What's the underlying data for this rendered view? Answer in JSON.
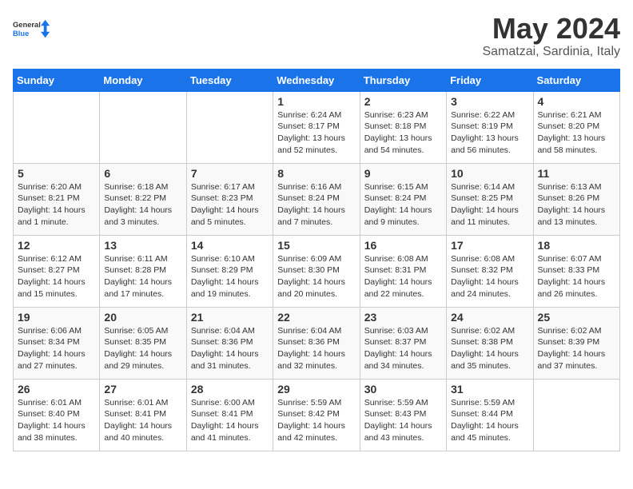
{
  "header": {
    "logo_general": "General",
    "logo_blue": "Blue",
    "title": "May 2024",
    "subtitle": "Samatzai, Sardinia, Italy"
  },
  "days_of_week": [
    "Sunday",
    "Monday",
    "Tuesday",
    "Wednesday",
    "Thursday",
    "Friday",
    "Saturday"
  ],
  "weeks": [
    [
      {
        "day": "",
        "info": ""
      },
      {
        "day": "",
        "info": ""
      },
      {
        "day": "",
        "info": ""
      },
      {
        "day": "1",
        "info": "Sunrise: 6:24 AM\nSunset: 8:17 PM\nDaylight: 13 hours\nand 52 minutes."
      },
      {
        "day": "2",
        "info": "Sunrise: 6:23 AM\nSunset: 8:18 PM\nDaylight: 13 hours\nand 54 minutes."
      },
      {
        "day": "3",
        "info": "Sunrise: 6:22 AM\nSunset: 8:19 PM\nDaylight: 13 hours\nand 56 minutes."
      },
      {
        "day": "4",
        "info": "Sunrise: 6:21 AM\nSunset: 8:20 PM\nDaylight: 13 hours\nand 58 minutes."
      }
    ],
    [
      {
        "day": "5",
        "info": "Sunrise: 6:20 AM\nSunset: 8:21 PM\nDaylight: 14 hours\nand 1 minute."
      },
      {
        "day": "6",
        "info": "Sunrise: 6:18 AM\nSunset: 8:22 PM\nDaylight: 14 hours\nand 3 minutes."
      },
      {
        "day": "7",
        "info": "Sunrise: 6:17 AM\nSunset: 8:23 PM\nDaylight: 14 hours\nand 5 minutes."
      },
      {
        "day": "8",
        "info": "Sunrise: 6:16 AM\nSunset: 8:24 PM\nDaylight: 14 hours\nand 7 minutes."
      },
      {
        "day": "9",
        "info": "Sunrise: 6:15 AM\nSunset: 8:24 PM\nDaylight: 14 hours\nand 9 minutes."
      },
      {
        "day": "10",
        "info": "Sunrise: 6:14 AM\nSunset: 8:25 PM\nDaylight: 14 hours\nand 11 minutes."
      },
      {
        "day": "11",
        "info": "Sunrise: 6:13 AM\nSunset: 8:26 PM\nDaylight: 14 hours\nand 13 minutes."
      }
    ],
    [
      {
        "day": "12",
        "info": "Sunrise: 6:12 AM\nSunset: 8:27 PM\nDaylight: 14 hours\nand 15 minutes."
      },
      {
        "day": "13",
        "info": "Sunrise: 6:11 AM\nSunset: 8:28 PM\nDaylight: 14 hours\nand 17 minutes."
      },
      {
        "day": "14",
        "info": "Sunrise: 6:10 AM\nSunset: 8:29 PM\nDaylight: 14 hours\nand 19 minutes."
      },
      {
        "day": "15",
        "info": "Sunrise: 6:09 AM\nSunset: 8:30 PM\nDaylight: 14 hours\nand 20 minutes."
      },
      {
        "day": "16",
        "info": "Sunrise: 6:08 AM\nSunset: 8:31 PM\nDaylight: 14 hours\nand 22 minutes."
      },
      {
        "day": "17",
        "info": "Sunrise: 6:08 AM\nSunset: 8:32 PM\nDaylight: 14 hours\nand 24 minutes."
      },
      {
        "day": "18",
        "info": "Sunrise: 6:07 AM\nSunset: 8:33 PM\nDaylight: 14 hours\nand 26 minutes."
      }
    ],
    [
      {
        "day": "19",
        "info": "Sunrise: 6:06 AM\nSunset: 8:34 PM\nDaylight: 14 hours\nand 27 minutes."
      },
      {
        "day": "20",
        "info": "Sunrise: 6:05 AM\nSunset: 8:35 PM\nDaylight: 14 hours\nand 29 minutes."
      },
      {
        "day": "21",
        "info": "Sunrise: 6:04 AM\nSunset: 8:36 PM\nDaylight: 14 hours\nand 31 minutes."
      },
      {
        "day": "22",
        "info": "Sunrise: 6:04 AM\nSunset: 8:36 PM\nDaylight: 14 hours\nand 32 minutes."
      },
      {
        "day": "23",
        "info": "Sunrise: 6:03 AM\nSunset: 8:37 PM\nDaylight: 14 hours\nand 34 minutes."
      },
      {
        "day": "24",
        "info": "Sunrise: 6:02 AM\nSunset: 8:38 PM\nDaylight: 14 hours\nand 35 minutes."
      },
      {
        "day": "25",
        "info": "Sunrise: 6:02 AM\nSunset: 8:39 PM\nDaylight: 14 hours\nand 37 minutes."
      }
    ],
    [
      {
        "day": "26",
        "info": "Sunrise: 6:01 AM\nSunset: 8:40 PM\nDaylight: 14 hours\nand 38 minutes."
      },
      {
        "day": "27",
        "info": "Sunrise: 6:01 AM\nSunset: 8:41 PM\nDaylight: 14 hours\nand 40 minutes."
      },
      {
        "day": "28",
        "info": "Sunrise: 6:00 AM\nSunset: 8:41 PM\nDaylight: 14 hours\nand 41 minutes."
      },
      {
        "day": "29",
        "info": "Sunrise: 5:59 AM\nSunset: 8:42 PM\nDaylight: 14 hours\nand 42 minutes."
      },
      {
        "day": "30",
        "info": "Sunrise: 5:59 AM\nSunset: 8:43 PM\nDaylight: 14 hours\nand 43 minutes."
      },
      {
        "day": "31",
        "info": "Sunrise: 5:59 AM\nSunset: 8:44 PM\nDaylight: 14 hours\nand 45 minutes."
      },
      {
        "day": "",
        "info": ""
      }
    ]
  ]
}
